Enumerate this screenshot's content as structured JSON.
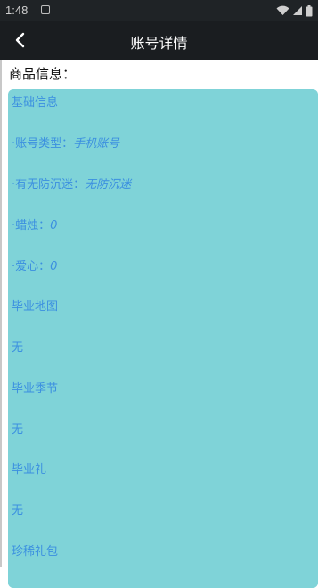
{
  "status_bar": {
    "time": "1:48",
    "icons": [
      "notification-icon",
      "wifi-icon",
      "signal-icon",
      "battery-icon"
    ]
  },
  "header": {
    "title": "账号详情",
    "back_icon": "chevron-left-icon"
  },
  "main": {
    "section_label": "商品信息：",
    "lines": [
      {
        "label": "基础信息",
        "value": ""
      },
      {
        "label": "·账号类型：",
        "value": "手机账号"
      },
      {
        "label": "·有无防沉迷：",
        "value": "无防沉迷"
      },
      {
        "label": "·蜡烛：",
        "value": "0"
      },
      {
        "label": "·爱心：",
        "value": "0"
      },
      {
        "label": "毕业地图",
        "value": ""
      },
      {
        "label": "无",
        "value": ""
      },
      {
        "label": "毕业季节",
        "value": ""
      },
      {
        "label": "无",
        "value": ""
      },
      {
        "label": "毕业礼",
        "value": ""
      },
      {
        "label": "无",
        "value": ""
      },
      {
        "label": "珍稀礼包",
        "value": ""
      }
    ]
  },
  "colors": {
    "status_bar_bg": "#1f2326",
    "title_bar_bg": "#1a1d20",
    "card_bg": "#7fd3d8",
    "card_text": "#3b8fe0"
  }
}
